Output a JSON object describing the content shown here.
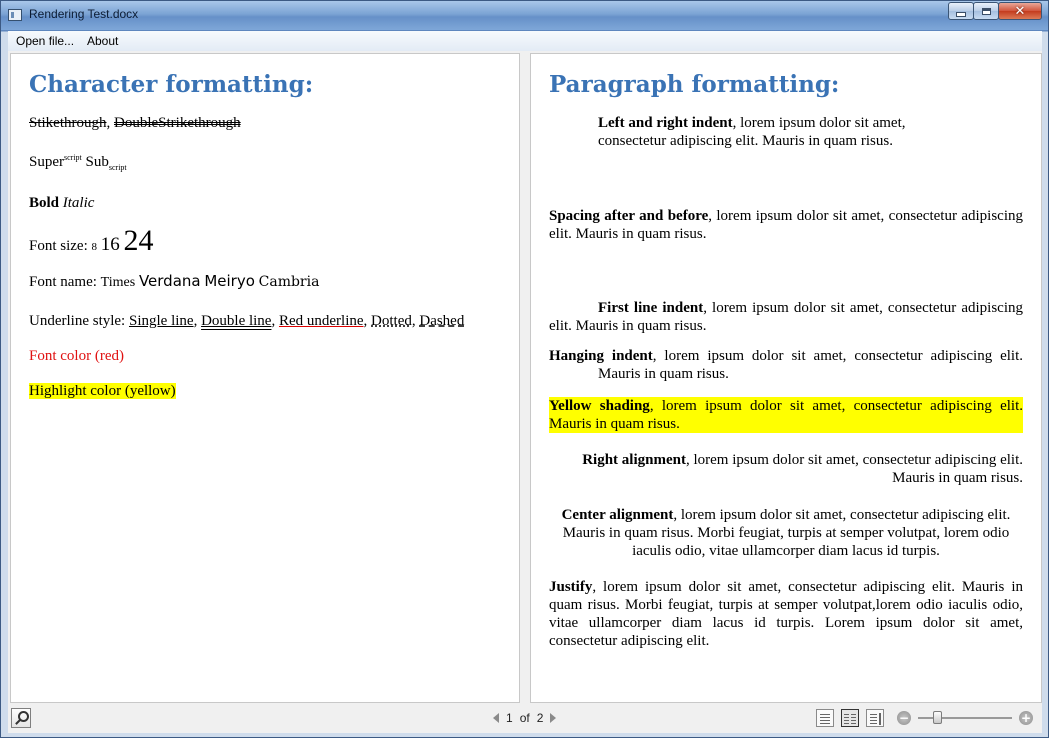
{
  "window": {
    "title": "Rendering Test.docx",
    "close_symbol": "✕"
  },
  "menu": {
    "open_file": "Open file...",
    "about": "About"
  },
  "left_page": {
    "heading": "Character formatting:",
    "strike": "Stikethrough",
    "strike_sep": ", ",
    "double_strike": "DoubleStrikethrough",
    "super_base": "Super",
    "super_script": "script",
    "sub_base": " Sub",
    "sub_script": "script",
    "bold": "Bold",
    "italic": "Italic",
    "font_size_label": "Font size: ",
    "size8": "8",
    "size16": "16",
    "size24": "24",
    "font_name_label": "Font name: ",
    "times": "Times",
    "verdana": "Verdana",
    "meiryo": "Meiryo",
    "cambria": "Cambria",
    "underline_label": "Underline style: ",
    "u_single": "Single line",
    "u_double": "Double line",
    "u_red": "Red underline",
    "u_dotted": "Dotted",
    "u_dashed": "Dashed",
    "comma": ", ",
    "font_color": "Font color (red)",
    "highlight": "Highlight color (yellow)"
  },
  "right_page": {
    "heading": "Paragraph formatting:",
    "p1_bold": "Left and right indent",
    "p1_text": ", lorem ipsum dolor sit amet, consectetur adipiscing elit. Mauris in quam risus.",
    "p2_bold": "Spacing after and before",
    "p2_text": ", lorem ipsum dolor sit amet, consectetur adipiscing elit. Mauris in quam risus.",
    "p3_bold": "First line indent",
    "p3_text": ", lorem ipsum dolor sit amet, consectetur adipiscing elit. Mauris in quam risus.",
    "p4_bold": "Hanging indent",
    "p4_text": ", lorem ipsum dolor sit amet, consectetur adipiscing elit. Mauris in quam risus.",
    "p5_bold": "Yellow shading",
    "p5_text": ", lorem ipsum dolor sit amet, consectetur adipiscing elit. Mauris in quam risus.",
    "p6_bold": "Right alignment",
    "p6_text": ", lorem ipsum dolor sit amet, consectetur adipiscing elit. Mauris in quam risus.",
    "p7_bold": "Center alignment",
    "p7_text": ", lorem ipsum dolor sit amet, consectetur adipiscing elit. Mauris in quam risus. Morbi feugiat, turpis at semper volutpat, lorem odio iaculis odio, vitae ullamcorper diam lacus id turpis.",
    "p8_bold": "Justify",
    "p8_text": ", lorem ipsum dolor sit amet, consectetur adipiscing elit. Mauris in quam risus. Morbi feugiat, turpis at semper volutpat,lorem odio iaculis odio, vitae ullamcorper diam lacus id turpis. Lorem ipsum dolor sit amet, consectetur adipiscing elit."
  },
  "status": {
    "current_page": "1",
    "of": "of",
    "total_pages": "2",
    "zoom_minus": "−",
    "zoom_plus": "+"
  }
}
